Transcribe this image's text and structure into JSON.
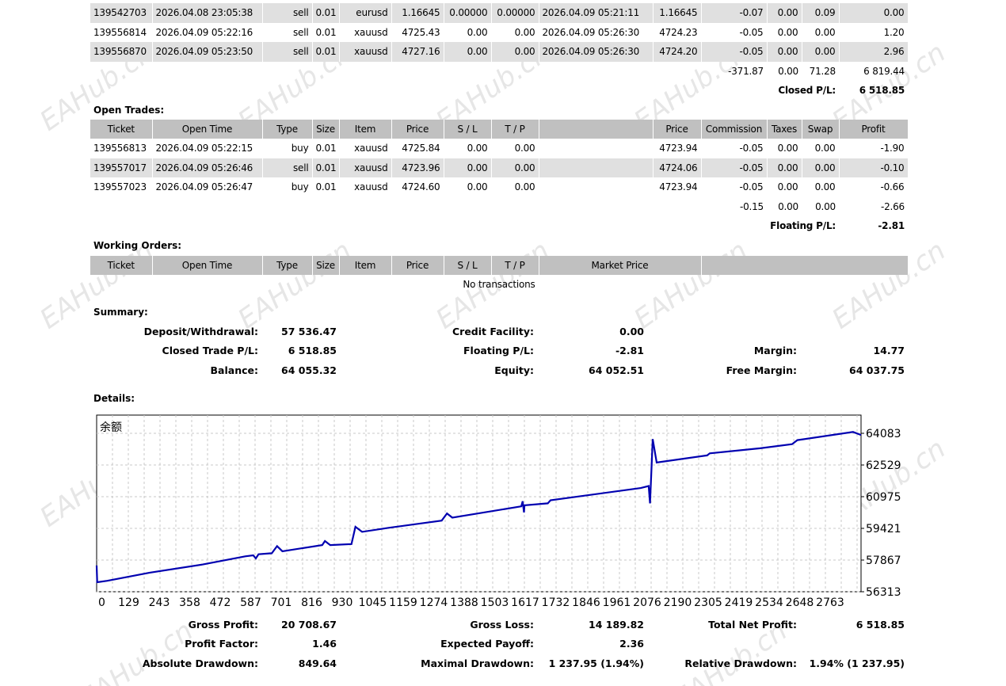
{
  "closed_trades": {
    "rows": [
      [
        "139542703",
        "2026.04.08 23:05:38",
        "sell",
        "0.01",
        "eurusd",
        "1.16645",
        "0.00000",
        "0.00000",
        "2026.04.09 05:21:11",
        "1.16645",
        "-0.07",
        "0.00",
        "0.09",
        "0.00"
      ],
      [
        "139556814",
        "2026.04.09 05:22:16",
        "sell",
        "0.01",
        "xauusd",
        "4725.43",
        "0.00",
        "0.00",
        "2026.04.09 05:26:30",
        "4724.23",
        "-0.05",
        "0.00",
        "0.00",
        "1.20"
      ],
      [
        "139556870",
        "2026.04.09 05:23:50",
        "sell",
        "0.01",
        "xauusd",
        "4727.16",
        "0.00",
        "0.00",
        "2026.04.09 05:26:30",
        "4724.20",
        "-0.05",
        "0.00",
        "0.00",
        "2.96"
      ]
    ],
    "totals": {
      "commission": "-371.87",
      "taxes": "0.00",
      "swap": "71.28",
      "profit": "6 819.44"
    },
    "closed_pl_label": "Closed P/L:",
    "closed_pl_value": "6 518.85"
  },
  "open_trades": {
    "title": "Open Trades:",
    "headers": [
      "Ticket",
      "Open Time",
      "Type",
      "Size",
      "Item",
      "Price",
      "S / L",
      "T / P",
      "",
      "Price",
      "Commission",
      "Taxes",
      "Swap",
      "Profit"
    ],
    "rows": [
      [
        "139556813",
        "2026.04.09 05:22:15",
        "buy",
        "0.01",
        "xauusd",
        "4725.84",
        "0.00",
        "0.00",
        "",
        "4723.94",
        "-0.05",
        "0.00",
        "0.00",
        "-1.90"
      ],
      [
        "139557017",
        "2026.04.09 05:26:46",
        "sell",
        "0.01",
        "xauusd",
        "4723.96",
        "0.00",
        "0.00",
        "",
        "4724.06",
        "-0.05",
        "0.00",
        "0.00",
        "-0.10"
      ],
      [
        "139557023",
        "2026.04.09 05:26:47",
        "buy",
        "0.01",
        "xauusd",
        "4724.60",
        "0.00",
        "0.00",
        "",
        "4723.94",
        "-0.05",
        "0.00",
        "0.00",
        "-0.66"
      ]
    ],
    "totals": {
      "commission": "-0.15",
      "taxes": "0.00",
      "swap": "0.00",
      "profit": "-2.66"
    },
    "floating_pl_label": "Floating P/L:",
    "floating_pl_value": "-2.81"
  },
  "working_orders": {
    "title": "Working Orders:",
    "headers": [
      "Ticket",
      "Open Time",
      "Type",
      "Size",
      "Item",
      "Price",
      "S / L",
      "T / P",
      "Market Price",
      ""
    ],
    "empty": "No transactions"
  },
  "summary": {
    "title": "Summary:",
    "items": [
      {
        "label": "Deposit/Withdrawal:",
        "value": "57 536.47"
      },
      {
        "label": "Credit Facility:",
        "value": "0.00"
      },
      {
        "label": "Closed Trade P/L:",
        "value": "6 518.85"
      },
      {
        "label": "Floating P/L:",
        "value": "-2.81"
      },
      {
        "label": "Margin:",
        "value": "14.77"
      },
      {
        "label": "Balance:",
        "value": "64 055.32"
      },
      {
        "label": "Equity:",
        "value": "64 052.51"
      },
      {
        "label": "Free Margin:",
        "value": "64 037.75"
      }
    ]
  },
  "details": {
    "title": "Details:",
    "stats": [
      {
        "label": "Gross Profit:",
        "value": "20 708.67"
      },
      {
        "label": "Gross Loss:",
        "value": "14 189.82"
      },
      {
        "label": "Total Net Profit:",
        "value": "6 518.85"
      },
      {
        "label": "Profit Factor:",
        "value": "1.46"
      },
      {
        "label": "Expected Payoff:",
        "value": "2.36"
      },
      {
        "label": "Absolute Drawdown:",
        "value": "849.64"
      },
      {
        "label": "Maximal Drawdown:",
        "value": "1 237.95 (1.94%)"
      },
      {
        "label": "Relative Drawdown:",
        "value": "1.94% (1 237.95)"
      }
    ]
  },
  "watermark": "EAHub.cn",
  "chart_data": {
    "type": "line",
    "title": "余额",
    "line_color": "#0000b0",
    "ylim": [
      56313,
      64083
    ],
    "xlim": [
      0,
      2880
    ],
    "yticks": [
      "64083",
      "62529",
      "60975",
      "59421",
      "57867",
      "56313"
    ],
    "xticks": [
      "0",
      "129",
      "243",
      "358",
      "472",
      "587",
      "701",
      "816",
      "930",
      "1045",
      "1159",
      "1274",
      "1388",
      "1503",
      "1617",
      "1732",
      "1846",
      "1961",
      "2076",
      "2190",
      "2305",
      "2419",
      "2534",
      "2648",
      "2763"
    ],
    "grid": true,
    "series": [
      {
        "name": "余额",
        "points": [
          [
            0,
            57600
          ],
          [
            2,
            56780
          ],
          [
            40,
            56850
          ],
          [
            200,
            57250
          ],
          [
            400,
            57650
          ],
          [
            560,
            58050
          ],
          [
            590,
            58100
          ],
          [
            600,
            57950
          ],
          [
            610,
            58150
          ],
          [
            660,
            58200
          ],
          [
            680,
            58550
          ],
          [
            700,
            58300
          ],
          [
            850,
            58600
          ],
          [
            860,
            58800
          ],
          [
            880,
            58600
          ],
          [
            960,
            58650
          ],
          [
            975,
            59500
          ],
          [
            1000,
            59250
          ],
          [
            1100,
            59450
          ],
          [
            1300,
            59800
          ],
          [
            1320,
            60150
          ],
          [
            1340,
            59950
          ],
          [
            1600,
            60500
          ],
          [
            1605,
            60750
          ],
          [
            1610,
            60200
          ],
          [
            1612,
            60550
          ],
          [
            1700,
            60650
          ],
          [
            1710,
            60800
          ],
          [
            2050,
            61400
          ],
          [
            2080,
            61500
          ],
          [
            2085,
            60650
          ],
          [
            2090,
            62200
          ],
          [
            2095,
            63800
          ],
          [
            2110,
            62650
          ],
          [
            2300,
            63000
          ],
          [
            2310,
            63100
          ],
          [
            2500,
            63350
          ],
          [
            2620,
            63550
          ],
          [
            2640,
            63750
          ],
          [
            2850,
            64150
          ],
          [
            2880,
            64000
          ]
        ]
      }
    ]
  }
}
